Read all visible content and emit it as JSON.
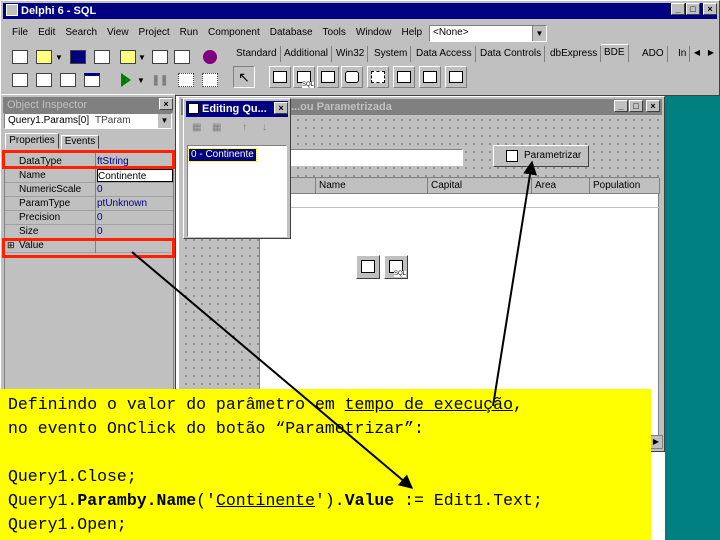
{
  "main_window": {
    "title": "Delphi 6 - SQL",
    "menu": [
      "File",
      "Edit",
      "Search",
      "View",
      "Project",
      "Run",
      "Component",
      "Database",
      "Tools",
      "Window",
      "Help"
    ],
    "config_combo": "<None>",
    "palette_tabs": [
      "Standard",
      "Additional",
      "Win32",
      "System",
      "Data Access",
      "Data Controls",
      "dbExpress",
      "BDE",
      "ADO",
      "In"
    ],
    "active_tab": "BDE",
    "bde_icon_labels": [
      "SQL"
    ]
  },
  "object_inspector": {
    "title": "Object Inspector",
    "selected_object": "Query1.Params[0]",
    "selected_type": "TParam",
    "tabs": [
      "Properties",
      "Events"
    ],
    "properties": [
      {
        "name": "DataType",
        "value": "ftString"
      },
      {
        "name": "Name",
        "value": "Continente"
      },
      {
        "name": "NumericScale",
        "value": "0"
      },
      {
        "name": "ParamType",
        "value": "ptUnknown"
      },
      {
        "name": "Precision",
        "value": "0"
      },
      {
        "name": "Size",
        "value": "0"
      },
      {
        "name": "Value",
        "value": ""
      }
    ],
    "value_expander": "⊞"
  },
  "editing_window": {
    "title": "Editing Qu...",
    "items": [
      "0 - Continente"
    ]
  },
  "form_window": {
    "title": "...ou Parametrizada",
    "button_label": "Parametrizar",
    "grid_columns": [
      "Name",
      "Capital",
      "Area",
      "Population"
    ],
    "icon_label": "SQL"
  },
  "callout": {
    "line1": "Definindo o valor do parâmetro em ",
    "line1_u": "tempo de execução",
    "line1_end": ",",
    "line2": "no evento OnClick do botão “Parametrizar”:",
    "code1": "Query1.Close;",
    "code2_a": "Query1.",
    "code2_b": "Paramby.Name",
    "code2_c": "('",
    "code2_str": "Continente",
    "code2_d": "').",
    "code2_e": "Value",
    "code2_f": " := Edit1.Text;",
    "code3": "Query1.Open;"
  },
  "colors": {
    "title_active": "#000080",
    "highlight_red": "#ff2000",
    "callout_yellow": "#ffff00",
    "desktop_teal": "#008080"
  }
}
